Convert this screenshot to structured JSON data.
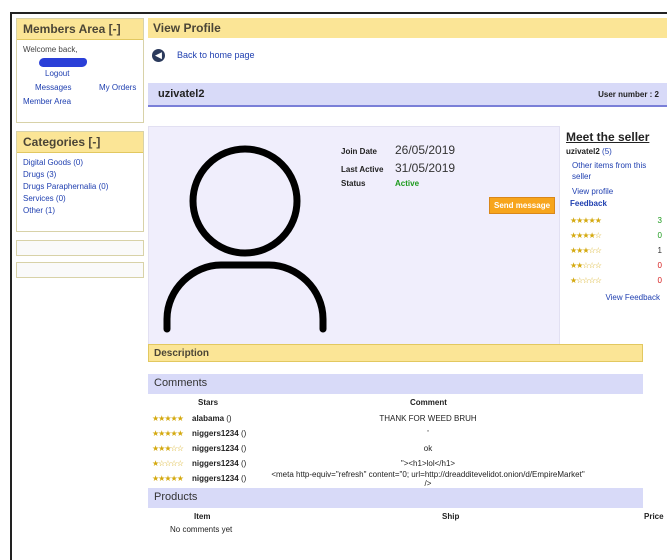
{
  "sidebar": {
    "members": {
      "title": "Members Area [-]",
      "welcome": "Welcome back,",
      "logout": "Logout",
      "messages": "Messages",
      "orders": "My Orders",
      "member_area": "Member Area"
    },
    "categories": {
      "title": "Categories [-]",
      "items": [
        "Digital Goods (0)",
        "Drugs (3)",
        "Drugs Paraphernalia (0)",
        "Services (0)",
        "Other (1)"
      ]
    }
  },
  "main": {
    "title": "View Profile",
    "back_link": "Back to home page",
    "back_icon": "arrow-left-icon",
    "username": "uzivatel2",
    "user_number": "User number : 2",
    "profile": {
      "avatar_icon": "user-silhouette-icon",
      "join_label": "Join Date",
      "join_value": "26/05/2019",
      "active_label": "Last Active",
      "active_value": "31/05/2019",
      "status_label": "Status",
      "status_value": "Active",
      "send_button": "Send message"
    },
    "seller": {
      "title": "Meet the seller",
      "name": "uzivatel2",
      "score": "(5)",
      "other_items": "Other items from this seller",
      "view_profile": "View profile",
      "feedback_label": "Feedback",
      "rows": [
        {
          "stars": "★★★★★",
          "count": "3",
          "color": "#1c9a1c"
        },
        {
          "stars": "★★★★☆",
          "count": "0",
          "color": "#1c9a1c"
        },
        {
          "stars": "★★★☆☆",
          "count": "1",
          "color": "#333333"
        },
        {
          "stars": "★★☆☆☆",
          "count": "0",
          "color": "#d61c1c"
        },
        {
          "stars": "★☆☆☆☆",
          "count": "0",
          "color": "#d61c1c"
        }
      ],
      "view_feedback": "View Feedback"
    },
    "description_title": "Description",
    "comments": {
      "title": "Comments",
      "col_stars": "Stars",
      "col_comment": "Comment",
      "rows": [
        {
          "stars": "★★★★★",
          "user": "alabama",
          "paren": "()",
          "comment": "THANK FOR WEED BRUH"
        },
        {
          "stars": "★★★★★",
          "user": "niggers1234",
          "paren": "()",
          "comment": "'"
        },
        {
          "stars": "★★★☆☆",
          "user": "niggers1234",
          "paren": "()",
          "comment": "ok"
        },
        {
          "stars": "★☆☆☆☆",
          "user": "niggers1234",
          "paren": "()",
          "comment": "\"><h1>lol</h1>"
        },
        {
          "stars": "★★★★★",
          "user": "niggers1234",
          "paren": "()",
          "comment": "<meta http-equiv=\"refresh\" content=\"0; url=http://dreadditevelidot.onion/d/EmpireMarket\" />"
        }
      ]
    },
    "products": {
      "title": "Products",
      "col_item": "Item",
      "col_ship": "Ship",
      "col_price": "Price",
      "empty": "No comments yet"
    }
  },
  "colors": {
    "yellow_header": "#fbe596",
    "lavender_bar": "#d8daf8",
    "link_blue": "#1f3fb0",
    "send_orange": "#f7a51c",
    "active_green": "#1c9a1c",
    "star_gold": "#d4a90f"
  }
}
